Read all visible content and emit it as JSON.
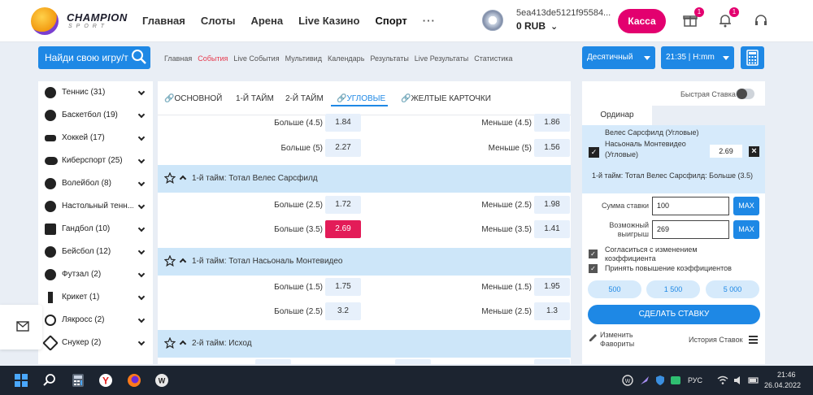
{
  "header": {
    "logo_line1": "CHAMPION",
    "logo_line2": "SPORT",
    "nav": [
      "Главная",
      "Слоты",
      "Арена",
      "Live Казино",
      "Спорт"
    ],
    "more": "···",
    "account_id": "5ea413de5121f95584...",
    "balance": "0 RUB",
    "cashier_label": "Касса",
    "gift_badge": "1",
    "bell_badge": "1"
  },
  "toolbar": {
    "search_label": "Найди свою игру/т",
    "subnav": [
      "Главная",
      "События",
      "Live События",
      "Мультивид",
      "Календарь",
      "Результаты",
      "Live Результаты",
      "Статистика"
    ],
    "odds_format": "Десятичный",
    "time_format": "21:35 | H:mm"
  },
  "sidebar": {
    "items": [
      {
        "label": "Теннис (31)",
        "icon": "tennis-icon"
      },
      {
        "label": "Баскетбол (19)",
        "icon": "basketball-icon"
      },
      {
        "label": "Хоккей (17)",
        "icon": "hockey-icon"
      },
      {
        "label": "Киберспорт (25)",
        "icon": "gamepad-icon"
      },
      {
        "label": "Волейбол (8)",
        "icon": "volleyball-icon"
      },
      {
        "label": "Настольный тенн...",
        "icon": "table-tennis-icon"
      },
      {
        "label": "Гандбол (10)",
        "icon": "handball-icon"
      },
      {
        "label": "Бейсбол (12)",
        "icon": "baseball-icon"
      },
      {
        "label": "Футзал (2)",
        "icon": "futsal-icon"
      },
      {
        "label": "Крикет (1)",
        "icon": "cricket-icon"
      },
      {
        "label": "Лякросс (2)",
        "icon": "lacrosse-icon"
      },
      {
        "label": "Снукер (2)",
        "icon": "snooker-icon"
      }
    ]
  },
  "tabs": [
    {
      "label": "ОСНОВНОЙ",
      "link": true
    },
    {
      "label": "1-Й ТАЙМ",
      "link": false
    },
    {
      "label": "2-Й ТАЙМ",
      "link": false
    },
    {
      "label": "УГЛОВЫЕ",
      "link": true
    },
    {
      "label": "ЖЕЛТЫЕ КАРТОЧКИ",
      "link": true
    }
  ],
  "markets": {
    "top_rows": [
      {
        "left": "Больше (4.5)",
        "left_odd": "1.84",
        "right": "Меньше (4.5)",
        "right_odd": "1.86"
      },
      {
        "left": "Больше (5)",
        "left_odd": "2.27",
        "right": "Меньше (5)",
        "right_odd": "1.56"
      }
    ],
    "m1": {
      "title": "1-й тайм: Тотал Велес Сарсфилд",
      "rows": [
        {
          "left": "Больше (2.5)",
          "left_odd": "1.72",
          "right": "Меньше (2.5)",
          "right_odd": "1.98"
        },
        {
          "left": "Больше (3.5)",
          "left_odd": "2.69",
          "right": "Меньше (3.5)",
          "right_odd": "1.41"
        }
      ]
    },
    "m2": {
      "title": "1-й тайм: Тотал Насьональ Монтевидео",
      "rows": [
        {
          "left": "Больше (1.5)",
          "left_odd": "1.75",
          "right": "Меньше (1.5)",
          "right_odd": "1.95"
        },
        {
          "left": "Больше (2.5)",
          "left_odd": "3.2",
          "right": "Меньше (2.5)",
          "right_odd": "1.3"
        }
      ]
    },
    "m3": {
      "title": "2-й тайм: Исход"
    }
  },
  "slip": {
    "quick_bet": "Быстрая Ставка",
    "tab": "Ординар",
    "teams_line1": "Велес Сарсфилд (Угловые)",
    "teams_line2": "Насьональ Монтевидео",
    "teams_line3": "(Угловые)",
    "odd": "2.69",
    "market": "1-й тайм: Тотал Велес Сарсфилд: Больше (3.5)",
    "stake_label": "Сумма ставки",
    "stake_value": "100",
    "win_label1": "Возможный",
    "win_label2": "выигрыш",
    "win_value": "269",
    "max": "MAX",
    "agree1": "Согласиться с изменением коэффициента",
    "agree2": "Принять повышение коэффициентов",
    "quick_amounts": [
      "500",
      "1 500",
      "5 000"
    ],
    "place": "СДЕЛАТЬ СТАВКУ",
    "fav1": "Изменить",
    "fav2": "Фавориты",
    "history": "История Ставок"
  },
  "taskbar": {
    "lang": "РУС",
    "time": "21:46",
    "date": "26.04.2022"
  }
}
